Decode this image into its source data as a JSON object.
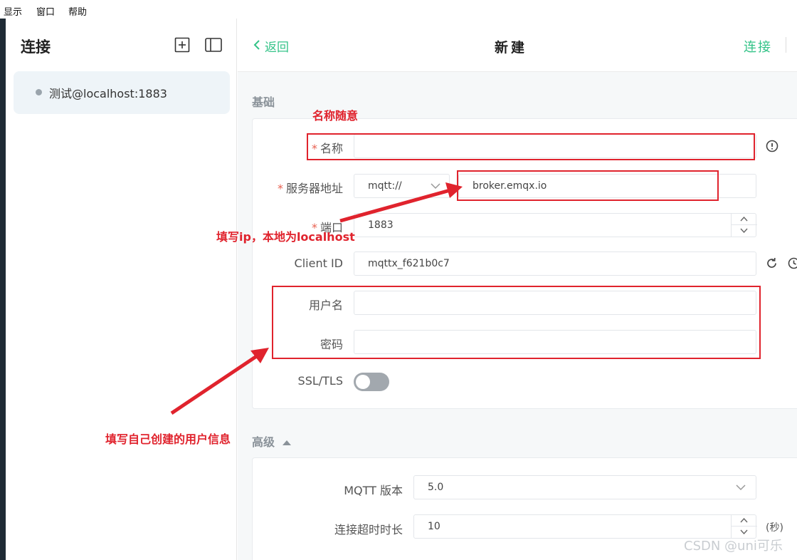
{
  "menubar": {
    "items": [
      "显示",
      "窗口",
      "帮助"
    ]
  },
  "sidebar": {
    "title": "连接",
    "icons": [
      "plus-square-icon",
      "panel-layout-icon"
    ],
    "connections": [
      {
        "label": "测试@localhost:1883"
      }
    ]
  },
  "header": {
    "back_label": "返回",
    "title": "新建",
    "connect_label": "连接"
  },
  "basic": {
    "section_label": "基础",
    "name": {
      "label": "名称",
      "value": ""
    },
    "server": {
      "label": "服务器地址",
      "protocol": "mqtt://",
      "host": "broker.emqx.io"
    },
    "port": {
      "label": "端口",
      "value": "1883"
    },
    "client_id": {
      "label": "Client ID",
      "value": "mqttx_f621b0c7"
    },
    "username": {
      "label": "用户名",
      "value": ""
    },
    "password": {
      "label": "密码",
      "value": ""
    },
    "ssl": {
      "label": "SSL/TLS",
      "enabled": false
    }
  },
  "advanced": {
    "section_label": "高级",
    "mqtt_version": {
      "label": "MQTT 版本",
      "value": "5.0"
    },
    "connect_timeout": {
      "label": "连接超时时长",
      "value": "10",
      "unit": "(秒)"
    }
  },
  "annotations": {
    "name_note": "名称随意",
    "ip_note": "填写ip，本地为localhost",
    "user_note": "填写自己创建的用户信息",
    "color": "#e0232d"
  },
  "watermark": "CSDN @uni可乐",
  "colors": {
    "accent": "#34c388",
    "required": "#e86050",
    "sidebar_strip": "#1f2b35"
  }
}
